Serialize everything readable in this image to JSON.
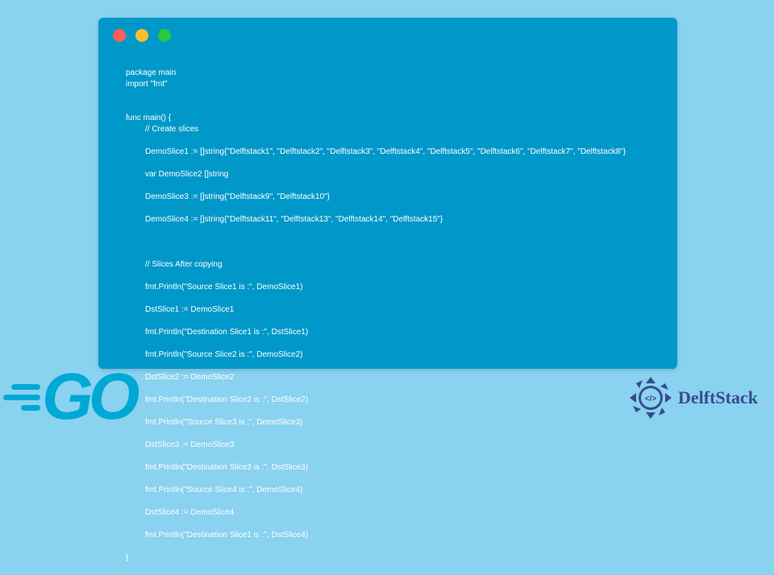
{
  "code": {
    "l1": "package main",
    "l2": "import \"fmt\"",
    "l3": "func main() {",
    "l4": "// Create slices",
    "l5": "DemoSlice1 := []string{\"Delftstack1\", \"Delftstack2\", \"Delftstack3\", \"Delftstack4\", \"Delftstack5\", \"Delftstack6\", \"Delftstack7\", \"Delftstack8\"}",
    "l6": "var DemoSlice2 []string",
    "l7": "DemoSlice3 := []string{\"Delftstack9\", \"Delftstack10\"}",
    "l8": "DemoSlice4 := []string{\"Delftstack11\", \"Delftstack13\", \"Delftstack14\", \"Delftstack15\"}",
    "l9": "// Slices After copying",
    "l10": "fmt.Println(\"Source Slice1 is :\", DemoSlice1)",
    "l11": "DstSlice1 := DemoSlice1",
    "l12": "fmt.Println(\"Destination Slice1 is :\", DstSlice1)",
    "l13": "fmt.Println(\"Source Slice2 is :\", DemoSlice2)",
    "l14": "DstSlice2 := DemoSlice2",
    "l15": "fmt.Println(\"Destination Slice2 is :\", DstSlice2)",
    "l16": "fmt.Println(\"Source Slice3 is :\", DemoSlice3)",
    "l17": "DstSlice3 := DemoSlice3",
    "l18": "fmt.Println(\"Destination Slice3 is :\", DstSlice3)",
    "l19": "fmt.Println(\"Source Slice4 is :\", DemoSlice4)",
    "l20": "DstSlice4 := DemoSlice4",
    "l21": "fmt.Println(\"Destination Slice1 is :\", DstSlice4)",
    "l22": "}"
  },
  "logos": {
    "go": "GO",
    "delft": "DelftStack"
  }
}
